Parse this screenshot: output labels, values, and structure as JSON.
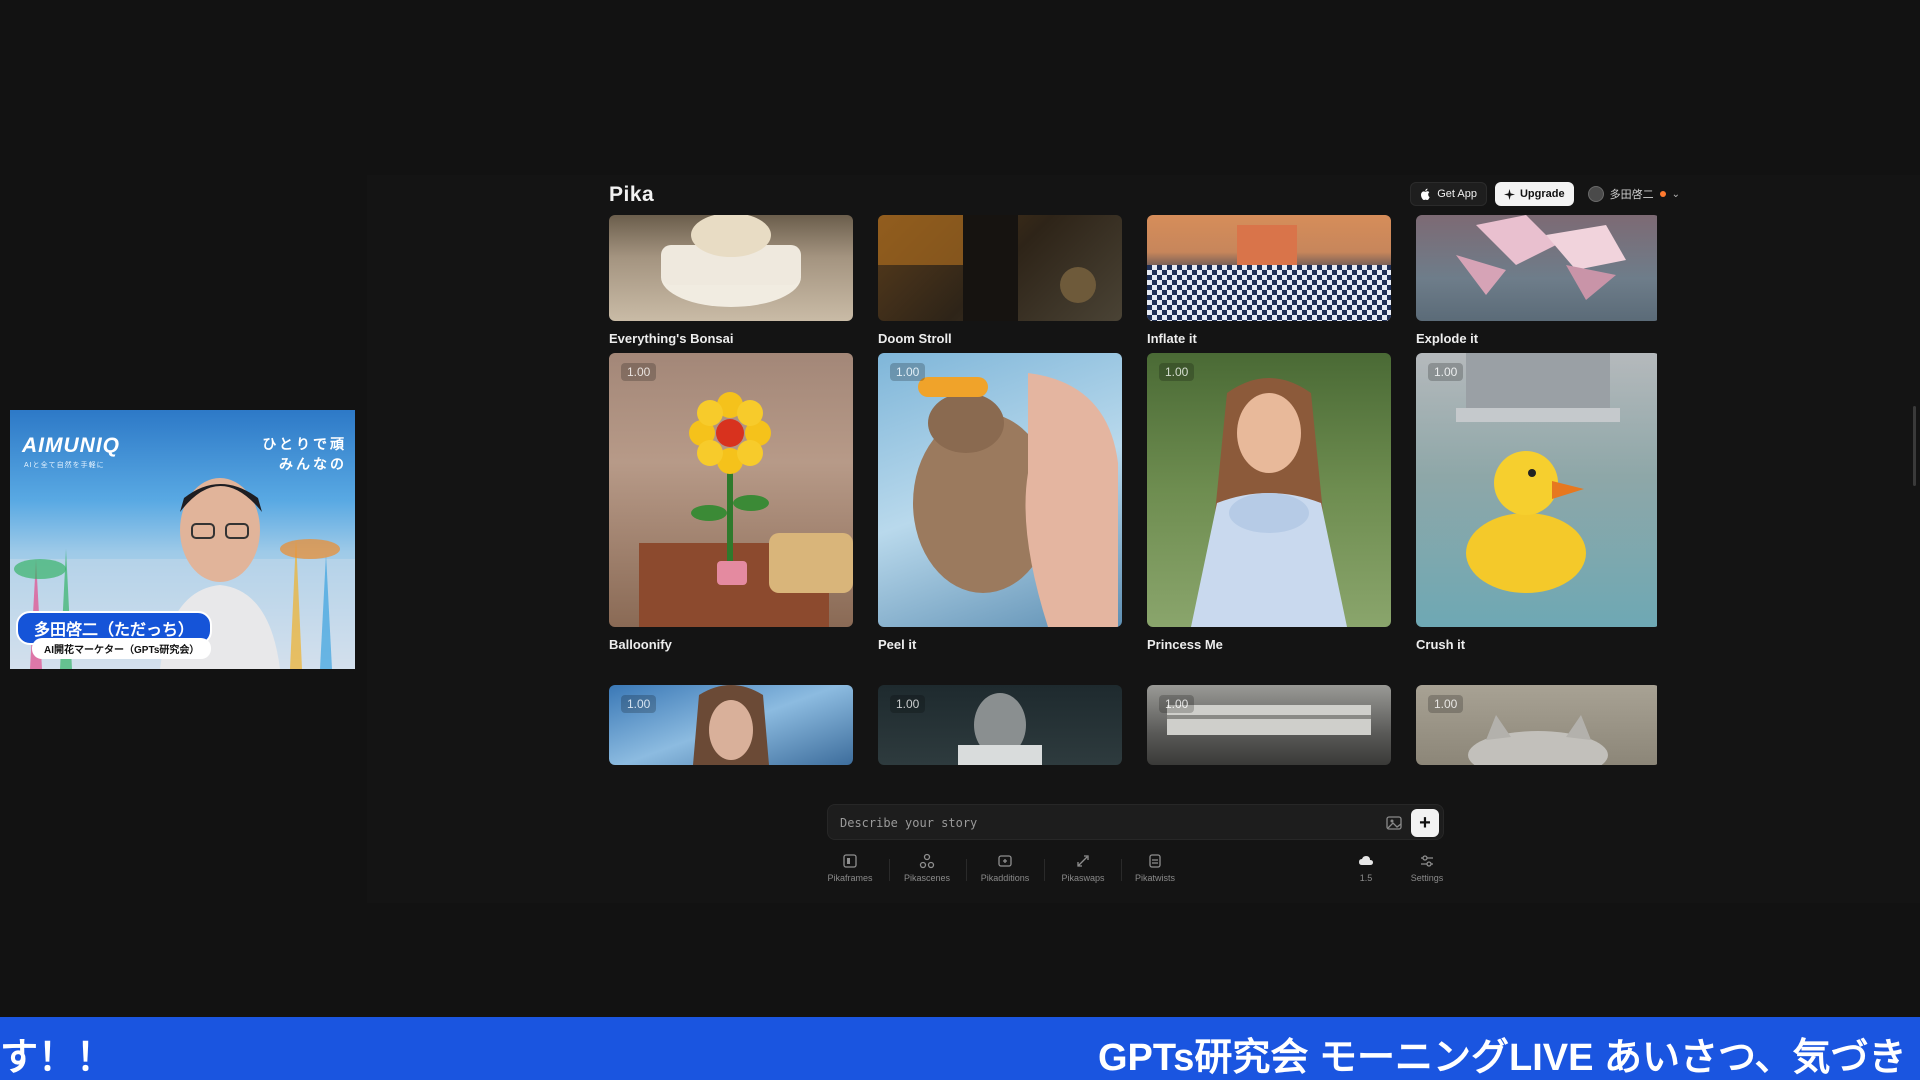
{
  "app": {
    "logo": "Pika",
    "header": {
      "get_app_label": "Get App",
      "upgrade_label": "Upgrade",
      "user_name": "多田啓二"
    }
  },
  "gallery": {
    "cards": [
      {
        "title": "Everything's Bonsai",
        "badge": ""
      },
      {
        "title": "Doom Stroll",
        "badge": ""
      },
      {
        "title": "Inflate it",
        "badge": ""
      },
      {
        "title": "Explode it",
        "badge": ""
      },
      {
        "title": "Balloonify",
        "badge": "1.00"
      },
      {
        "title": "Peel it",
        "badge": "1.00"
      },
      {
        "title": "Princess Me",
        "badge": "1.00"
      },
      {
        "title": "Crush it",
        "badge": "1.00"
      },
      {
        "title": "",
        "badge": "1.00"
      },
      {
        "title": "",
        "badge": "1.00"
      },
      {
        "title": "",
        "badge": "1.00"
      },
      {
        "title": "",
        "badge": "1.00"
      }
    ]
  },
  "prompt": {
    "placeholder": "Describe your story"
  },
  "toolbar": {
    "tools": [
      {
        "label": "Pikaframes",
        "icon": "frames-icon"
      },
      {
        "label": "Pikascenes",
        "icon": "scenes-icon"
      },
      {
        "label": "Pikadditions",
        "icon": "additions-icon"
      },
      {
        "label": "Pikaswaps",
        "icon": "swaps-icon"
      },
      {
        "label": "Pikatwists",
        "icon": "twists-icon"
      }
    ],
    "model_label": "1.5",
    "settings_label": "Settings"
  },
  "webcam": {
    "brand": "AIMUNIQ",
    "brand_sub": "AIと全て自然を手軽に",
    "right_line1": "ひとりで頑",
    "right_line2": "みんなの",
    "name_tag": "多田啓二（ただっち）",
    "title_tag": "AI開花マーケター（GPTs研究会）"
  },
  "ticker": {
    "left_text": "す！！",
    "right_text": "GPTs研究会 モーニングLIVE あいさつ、気づき"
  }
}
